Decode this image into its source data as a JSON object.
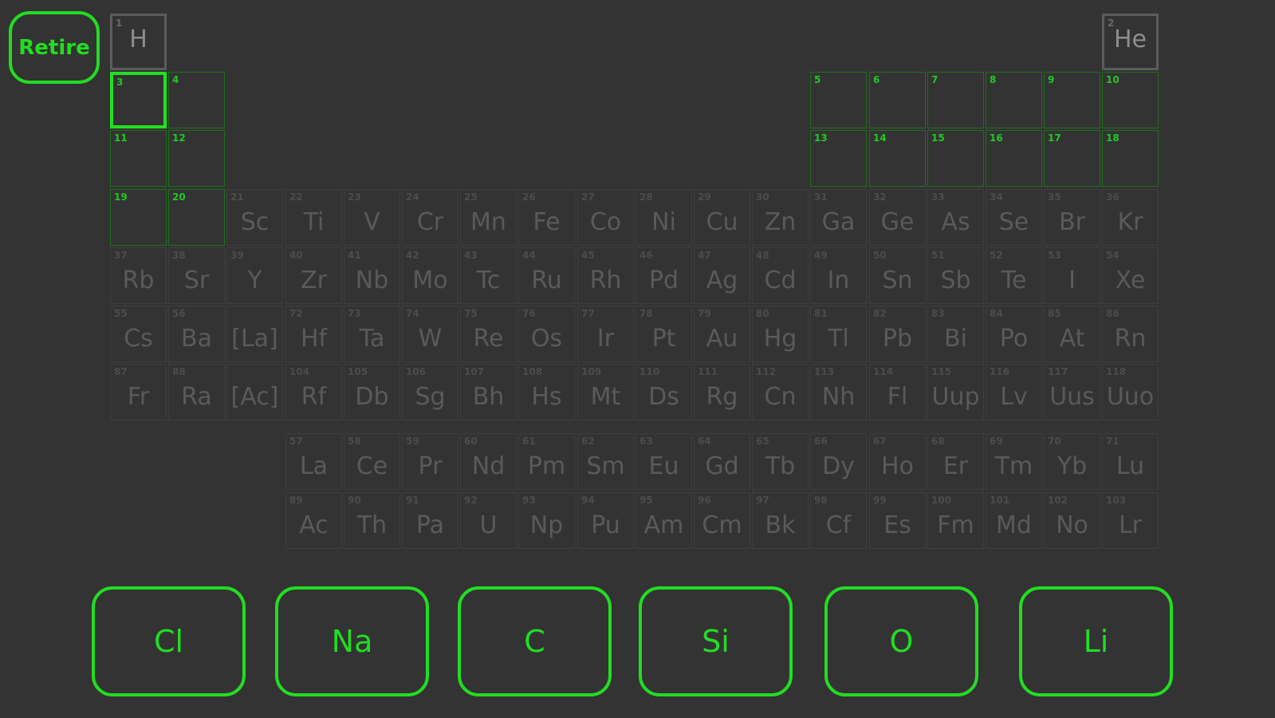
{
  "retire_label": "Retire",
  "colors": {
    "accent": "#22dd22",
    "background": "#333333"
  },
  "selected_number": 3,
  "elements": [
    {
      "n": 1,
      "s": "H",
      "state": "known",
      "r": 0,
      "c": 0
    },
    {
      "n": 2,
      "s": "He",
      "state": "known",
      "r": 0,
      "c": 17
    },
    {
      "n": 3,
      "s": "",
      "state": "blank",
      "r": 1,
      "c": 0
    },
    {
      "n": 4,
      "s": "",
      "state": "blank",
      "r": 1,
      "c": 1
    },
    {
      "n": 5,
      "s": "",
      "state": "blank",
      "r": 1,
      "c": 12
    },
    {
      "n": 6,
      "s": "",
      "state": "blank",
      "r": 1,
      "c": 13
    },
    {
      "n": 7,
      "s": "",
      "state": "blank",
      "r": 1,
      "c": 14
    },
    {
      "n": 8,
      "s": "",
      "state": "blank",
      "r": 1,
      "c": 15
    },
    {
      "n": 9,
      "s": "",
      "state": "blank",
      "r": 1,
      "c": 16
    },
    {
      "n": 10,
      "s": "",
      "state": "blank",
      "r": 1,
      "c": 17
    },
    {
      "n": 11,
      "s": "",
      "state": "blank",
      "r": 2,
      "c": 0
    },
    {
      "n": 12,
      "s": "",
      "state": "blank",
      "r": 2,
      "c": 1
    },
    {
      "n": 13,
      "s": "",
      "state": "blank",
      "r": 2,
      "c": 12
    },
    {
      "n": 14,
      "s": "",
      "state": "blank",
      "r": 2,
      "c": 13
    },
    {
      "n": 15,
      "s": "",
      "state": "blank",
      "r": 2,
      "c": 14
    },
    {
      "n": 16,
      "s": "",
      "state": "blank",
      "r": 2,
      "c": 15
    },
    {
      "n": 17,
      "s": "",
      "state": "blank",
      "r": 2,
      "c": 16
    },
    {
      "n": 18,
      "s": "",
      "state": "blank",
      "r": 2,
      "c": 17
    },
    {
      "n": 19,
      "s": "",
      "state": "blank",
      "r": 3,
      "c": 0
    },
    {
      "n": 20,
      "s": "",
      "state": "blank",
      "r": 3,
      "c": 1
    },
    {
      "n": 21,
      "s": "Sc",
      "state": "dim",
      "r": 3,
      "c": 2
    },
    {
      "n": 22,
      "s": "Ti",
      "state": "dim",
      "r": 3,
      "c": 3
    },
    {
      "n": 23,
      "s": "V",
      "state": "dim",
      "r": 3,
      "c": 4
    },
    {
      "n": 24,
      "s": "Cr",
      "state": "dim",
      "r": 3,
      "c": 5
    },
    {
      "n": 25,
      "s": "Mn",
      "state": "dim",
      "r": 3,
      "c": 6
    },
    {
      "n": 26,
      "s": "Fe",
      "state": "dim",
      "r": 3,
      "c": 7
    },
    {
      "n": 27,
      "s": "Co",
      "state": "dim",
      "r": 3,
      "c": 8
    },
    {
      "n": 28,
      "s": "Ni",
      "state": "dim",
      "r": 3,
      "c": 9
    },
    {
      "n": 29,
      "s": "Cu",
      "state": "dim",
      "r": 3,
      "c": 10
    },
    {
      "n": 30,
      "s": "Zn",
      "state": "dim",
      "r": 3,
      "c": 11
    },
    {
      "n": 31,
      "s": "Ga",
      "state": "dim",
      "r": 3,
      "c": 12
    },
    {
      "n": 32,
      "s": "Ge",
      "state": "dim",
      "r": 3,
      "c": 13
    },
    {
      "n": 33,
      "s": "As",
      "state": "dim",
      "r": 3,
      "c": 14
    },
    {
      "n": 34,
      "s": "Se",
      "state": "dim",
      "r": 3,
      "c": 15
    },
    {
      "n": 35,
      "s": "Br",
      "state": "dim",
      "r": 3,
      "c": 16
    },
    {
      "n": 36,
      "s": "Kr",
      "state": "dim",
      "r": 3,
      "c": 17
    },
    {
      "n": 37,
      "s": "Rb",
      "state": "dim",
      "r": 4,
      "c": 0
    },
    {
      "n": 38,
      "s": "Sr",
      "state": "dim",
      "r": 4,
      "c": 1
    },
    {
      "n": 39,
      "s": "Y",
      "state": "dim",
      "r": 4,
      "c": 2
    },
    {
      "n": 40,
      "s": "Zr",
      "state": "dim",
      "r": 4,
      "c": 3
    },
    {
      "n": 41,
      "s": "Nb",
      "state": "dim",
      "r": 4,
      "c": 4
    },
    {
      "n": 42,
      "s": "Mo",
      "state": "dim",
      "r": 4,
      "c": 5
    },
    {
      "n": 43,
      "s": "Tc",
      "state": "dim",
      "r": 4,
      "c": 6
    },
    {
      "n": 44,
      "s": "Ru",
      "state": "dim",
      "r": 4,
      "c": 7
    },
    {
      "n": 45,
      "s": "Rh",
      "state": "dim",
      "r": 4,
      "c": 8
    },
    {
      "n": 46,
      "s": "Pd",
      "state": "dim",
      "r": 4,
      "c": 9
    },
    {
      "n": 47,
      "s": "Ag",
      "state": "dim",
      "r": 4,
      "c": 10
    },
    {
      "n": 48,
      "s": "Cd",
      "state": "dim",
      "r": 4,
      "c": 11
    },
    {
      "n": 49,
      "s": "In",
      "state": "dim",
      "r": 4,
      "c": 12
    },
    {
      "n": 50,
      "s": "Sn",
      "state": "dim",
      "r": 4,
      "c": 13
    },
    {
      "n": 51,
      "s": "Sb",
      "state": "dim",
      "r": 4,
      "c": 14
    },
    {
      "n": 52,
      "s": "Te",
      "state": "dim",
      "r": 4,
      "c": 15
    },
    {
      "n": 53,
      "s": "I",
      "state": "dim",
      "r": 4,
      "c": 16
    },
    {
      "n": 54,
      "s": "Xe",
      "state": "dim",
      "r": 4,
      "c": 17
    },
    {
      "n": 55,
      "s": "Cs",
      "state": "dim",
      "r": 5,
      "c": 0
    },
    {
      "n": 56,
      "s": "Ba",
      "state": "dim",
      "r": 5,
      "c": 1
    },
    {
      "n": "",
      "s": "[La]",
      "state": "dim",
      "r": 5,
      "c": 2
    },
    {
      "n": 72,
      "s": "Hf",
      "state": "dim",
      "r": 5,
      "c": 3
    },
    {
      "n": 73,
      "s": "Ta",
      "state": "dim",
      "r": 5,
      "c": 4
    },
    {
      "n": 74,
      "s": "W",
      "state": "dim",
      "r": 5,
      "c": 5
    },
    {
      "n": 75,
      "s": "Re",
      "state": "dim",
      "r": 5,
      "c": 6
    },
    {
      "n": 76,
      "s": "Os",
      "state": "dim",
      "r": 5,
      "c": 7
    },
    {
      "n": 77,
      "s": "Ir",
      "state": "dim",
      "r": 5,
      "c": 8
    },
    {
      "n": 78,
      "s": "Pt",
      "state": "dim",
      "r": 5,
      "c": 9
    },
    {
      "n": 79,
      "s": "Au",
      "state": "dim",
      "r": 5,
      "c": 10
    },
    {
      "n": 80,
      "s": "Hg",
      "state": "dim",
      "r": 5,
      "c": 11
    },
    {
      "n": 81,
      "s": "Tl",
      "state": "dim",
      "r": 5,
      "c": 12
    },
    {
      "n": 82,
      "s": "Pb",
      "state": "dim",
      "r": 5,
      "c": 13
    },
    {
      "n": 83,
      "s": "Bi",
      "state": "dim",
      "r": 5,
      "c": 14
    },
    {
      "n": 84,
      "s": "Po",
      "state": "dim",
      "r": 5,
      "c": 15
    },
    {
      "n": 85,
      "s": "At",
      "state": "dim",
      "r": 5,
      "c": 16
    },
    {
      "n": 86,
      "s": "Rn",
      "state": "dim",
      "r": 5,
      "c": 17
    },
    {
      "n": 87,
      "s": "Fr",
      "state": "dim",
      "r": 6,
      "c": 0
    },
    {
      "n": 88,
      "s": "Ra",
      "state": "dim",
      "r": 6,
      "c": 1
    },
    {
      "n": "",
      "s": "[Ac]",
      "state": "dim",
      "r": 6,
      "c": 2
    },
    {
      "n": 104,
      "s": "Rf",
      "state": "dim",
      "r": 6,
      "c": 3
    },
    {
      "n": 105,
      "s": "Db",
      "state": "dim",
      "r": 6,
      "c": 4
    },
    {
      "n": 106,
      "s": "Sg",
      "state": "dim",
      "r": 6,
      "c": 5
    },
    {
      "n": 107,
      "s": "Bh",
      "state": "dim",
      "r": 6,
      "c": 6
    },
    {
      "n": 108,
      "s": "Hs",
      "state": "dim",
      "r": 6,
      "c": 7
    },
    {
      "n": 109,
      "s": "Mt",
      "state": "dim",
      "r": 6,
      "c": 8
    },
    {
      "n": 110,
      "s": "Ds",
      "state": "dim",
      "r": 6,
      "c": 9
    },
    {
      "n": 111,
      "s": "Rg",
      "state": "dim",
      "r": 6,
      "c": 10
    },
    {
      "n": 112,
      "s": "Cn",
      "state": "dim",
      "r": 6,
      "c": 11
    },
    {
      "n": 113,
      "s": "Nh",
      "state": "dim",
      "r": 6,
      "c": 12
    },
    {
      "n": 114,
      "s": "Fl",
      "state": "dim",
      "r": 6,
      "c": 13
    },
    {
      "n": 115,
      "s": "Uup",
      "state": "dim",
      "r": 6,
      "c": 14
    },
    {
      "n": 116,
      "s": "Lv",
      "state": "dim",
      "r": 6,
      "c": 15
    },
    {
      "n": 117,
      "s": "Uus",
      "state": "dim",
      "r": 6,
      "c": 16
    },
    {
      "n": 118,
      "s": "Uuo",
      "state": "dim",
      "r": 6,
      "c": 17
    },
    {
      "n": 57,
      "s": "La",
      "state": "dim",
      "r": 7,
      "c": 3
    },
    {
      "n": 58,
      "s": "Ce",
      "state": "dim",
      "r": 7,
      "c": 4
    },
    {
      "n": 59,
      "s": "Pr",
      "state": "dim",
      "r": 7,
      "c": 5
    },
    {
      "n": 60,
      "s": "Nd",
      "state": "dim",
      "r": 7,
      "c": 6
    },
    {
      "n": 61,
      "s": "Pm",
      "state": "dim",
      "r": 7,
      "c": 7
    },
    {
      "n": 62,
      "s": "Sm",
      "state": "dim",
      "r": 7,
      "c": 8
    },
    {
      "n": 63,
      "s": "Eu",
      "state": "dim",
      "r": 7,
      "c": 9
    },
    {
      "n": 64,
      "s": "Gd",
      "state": "dim",
      "r": 7,
      "c": 10
    },
    {
      "n": 65,
      "s": "Tb",
      "state": "dim",
      "r": 7,
      "c": 11
    },
    {
      "n": 66,
      "s": "Dy",
      "state": "dim",
      "r": 7,
      "c": 12
    },
    {
      "n": 67,
      "s": "Ho",
      "state": "dim",
      "r": 7,
      "c": 13
    },
    {
      "n": 68,
      "s": "Er",
      "state": "dim",
      "r": 7,
      "c": 14
    },
    {
      "n": 69,
      "s": "Tm",
      "state": "dim",
      "r": 7,
      "c": 15
    },
    {
      "n": 70,
      "s": "Yb",
      "state": "dim",
      "r": 7,
      "c": 16
    },
    {
      "n": 71,
      "s": "Lu",
      "state": "dim",
      "r": 7,
      "c": 17
    },
    {
      "n": 89,
      "s": "Ac",
      "state": "dim",
      "r": 8,
      "c": 3
    },
    {
      "n": 90,
      "s": "Th",
      "state": "dim",
      "r": 8,
      "c": 4
    },
    {
      "n": 91,
      "s": "Pa",
      "state": "dim",
      "r": 8,
      "c": 5
    },
    {
      "n": 92,
      "s": "U",
      "state": "dim",
      "r": 8,
      "c": 6
    },
    {
      "n": 93,
      "s": "Np",
      "state": "dim",
      "r": 8,
      "c": 7
    },
    {
      "n": 94,
      "s": "Pu",
      "state": "dim",
      "r": 8,
      "c": 8
    },
    {
      "n": 95,
      "s": "Am",
      "state": "dim",
      "r": 8,
      "c": 9
    },
    {
      "n": 96,
      "s": "Cm",
      "state": "dim",
      "r": 8,
      "c": 10
    },
    {
      "n": 97,
      "s": "Bk",
      "state": "dim",
      "r": 8,
      "c": 11
    },
    {
      "n": 98,
      "s": "Cf",
      "state": "dim",
      "r": 8,
      "c": 12
    },
    {
      "n": 99,
      "s": "Es",
      "state": "dim",
      "r": 8,
      "c": 13
    },
    {
      "n": 100,
      "s": "Fm",
      "state": "dim",
      "r": 8,
      "c": 14
    },
    {
      "n": 101,
      "s": "Md",
      "state": "dim",
      "r": 8,
      "c": 15
    },
    {
      "n": 102,
      "s": "No",
      "state": "dim",
      "r": 8,
      "c": 16
    },
    {
      "n": 103,
      "s": "Lr",
      "state": "dim",
      "r": 8,
      "c": 17
    }
  ],
  "choices": [
    "Cl",
    "Na",
    "C",
    "Si",
    "O",
    "Li"
  ]
}
